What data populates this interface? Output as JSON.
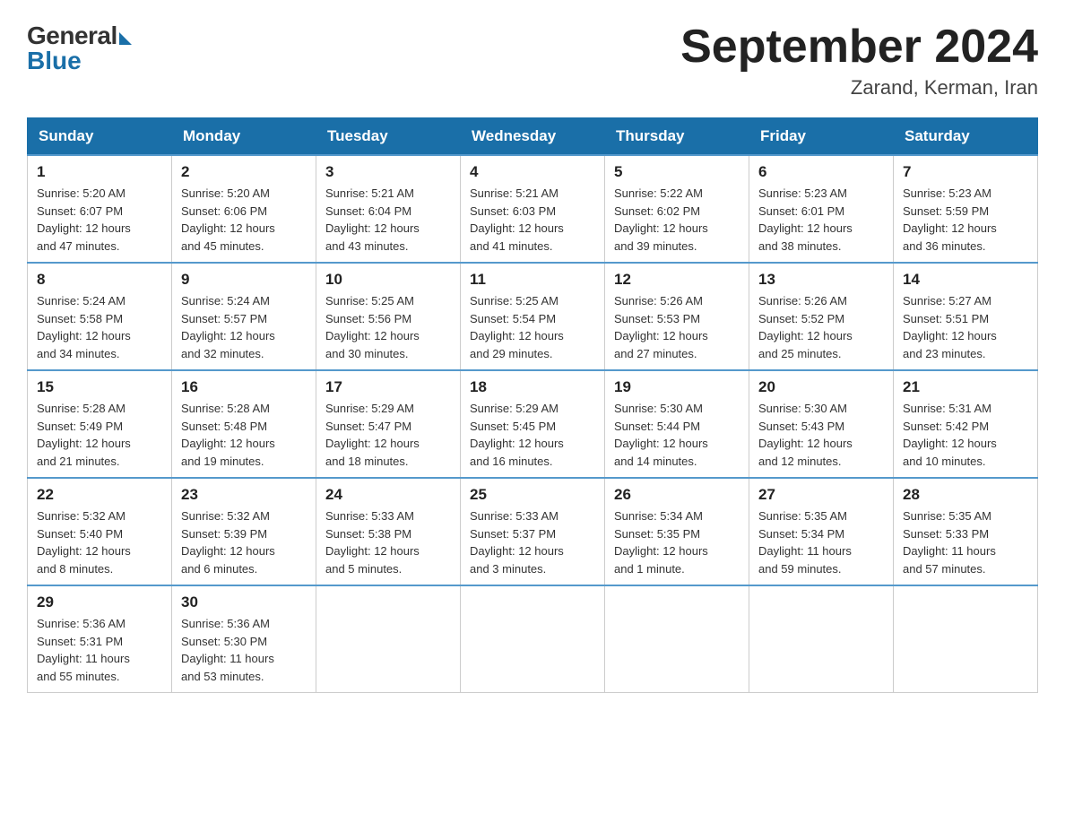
{
  "logo": {
    "general": "General",
    "blue": "Blue"
  },
  "title": "September 2024",
  "location": "Zarand, Kerman, Iran",
  "weekdays": [
    "Sunday",
    "Monday",
    "Tuesday",
    "Wednesday",
    "Thursday",
    "Friday",
    "Saturday"
  ],
  "weeks": [
    [
      {
        "day": "1",
        "sunrise": "5:20 AM",
        "sunset": "6:07 PM",
        "daylight": "12 hours and 47 minutes."
      },
      {
        "day": "2",
        "sunrise": "5:20 AM",
        "sunset": "6:06 PM",
        "daylight": "12 hours and 45 minutes."
      },
      {
        "day": "3",
        "sunrise": "5:21 AM",
        "sunset": "6:04 PM",
        "daylight": "12 hours and 43 minutes."
      },
      {
        "day": "4",
        "sunrise": "5:21 AM",
        "sunset": "6:03 PM",
        "daylight": "12 hours and 41 minutes."
      },
      {
        "day": "5",
        "sunrise": "5:22 AM",
        "sunset": "6:02 PM",
        "daylight": "12 hours and 39 minutes."
      },
      {
        "day": "6",
        "sunrise": "5:23 AM",
        "sunset": "6:01 PM",
        "daylight": "12 hours and 38 minutes."
      },
      {
        "day": "7",
        "sunrise": "5:23 AM",
        "sunset": "5:59 PM",
        "daylight": "12 hours and 36 minutes."
      }
    ],
    [
      {
        "day": "8",
        "sunrise": "5:24 AM",
        "sunset": "5:58 PM",
        "daylight": "12 hours and 34 minutes."
      },
      {
        "day": "9",
        "sunrise": "5:24 AM",
        "sunset": "5:57 PM",
        "daylight": "12 hours and 32 minutes."
      },
      {
        "day": "10",
        "sunrise": "5:25 AM",
        "sunset": "5:56 PM",
        "daylight": "12 hours and 30 minutes."
      },
      {
        "day": "11",
        "sunrise": "5:25 AM",
        "sunset": "5:54 PM",
        "daylight": "12 hours and 29 minutes."
      },
      {
        "day": "12",
        "sunrise": "5:26 AM",
        "sunset": "5:53 PM",
        "daylight": "12 hours and 27 minutes."
      },
      {
        "day": "13",
        "sunrise": "5:26 AM",
        "sunset": "5:52 PM",
        "daylight": "12 hours and 25 minutes."
      },
      {
        "day": "14",
        "sunrise": "5:27 AM",
        "sunset": "5:51 PM",
        "daylight": "12 hours and 23 minutes."
      }
    ],
    [
      {
        "day": "15",
        "sunrise": "5:28 AM",
        "sunset": "5:49 PM",
        "daylight": "12 hours and 21 minutes."
      },
      {
        "day": "16",
        "sunrise": "5:28 AM",
        "sunset": "5:48 PM",
        "daylight": "12 hours and 19 minutes."
      },
      {
        "day": "17",
        "sunrise": "5:29 AM",
        "sunset": "5:47 PM",
        "daylight": "12 hours and 18 minutes."
      },
      {
        "day": "18",
        "sunrise": "5:29 AM",
        "sunset": "5:45 PM",
        "daylight": "12 hours and 16 minutes."
      },
      {
        "day": "19",
        "sunrise": "5:30 AM",
        "sunset": "5:44 PM",
        "daylight": "12 hours and 14 minutes."
      },
      {
        "day": "20",
        "sunrise": "5:30 AM",
        "sunset": "5:43 PM",
        "daylight": "12 hours and 12 minutes."
      },
      {
        "day": "21",
        "sunrise": "5:31 AM",
        "sunset": "5:42 PM",
        "daylight": "12 hours and 10 minutes."
      }
    ],
    [
      {
        "day": "22",
        "sunrise": "5:32 AM",
        "sunset": "5:40 PM",
        "daylight": "12 hours and 8 minutes."
      },
      {
        "day": "23",
        "sunrise": "5:32 AM",
        "sunset": "5:39 PM",
        "daylight": "12 hours and 6 minutes."
      },
      {
        "day": "24",
        "sunrise": "5:33 AM",
        "sunset": "5:38 PM",
        "daylight": "12 hours and 5 minutes."
      },
      {
        "day": "25",
        "sunrise": "5:33 AM",
        "sunset": "5:37 PM",
        "daylight": "12 hours and 3 minutes."
      },
      {
        "day": "26",
        "sunrise": "5:34 AM",
        "sunset": "5:35 PM",
        "daylight": "12 hours and 1 minute."
      },
      {
        "day": "27",
        "sunrise": "5:35 AM",
        "sunset": "5:34 PM",
        "daylight": "11 hours and 59 minutes."
      },
      {
        "day": "28",
        "sunrise": "5:35 AM",
        "sunset": "5:33 PM",
        "daylight": "11 hours and 57 minutes."
      }
    ],
    [
      {
        "day": "29",
        "sunrise": "5:36 AM",
        "sunset": "5:31 PM",
        "daylight": "11 hours and 55 minutes."
      },
      {
        "day": "30",
        "sunrise": "5:36 AM",
        "sunset": "5:30 PM",
        "daylight": "11 hours and 53 minutes."
      },
      null,
      null,
      null,
      null,
      null
    ]
  ],
  "labels": {
    "sunrise": "Sunrise:",
    "sunset": "Sunset:",
    "daylight": "Daylight:"
  }
}
